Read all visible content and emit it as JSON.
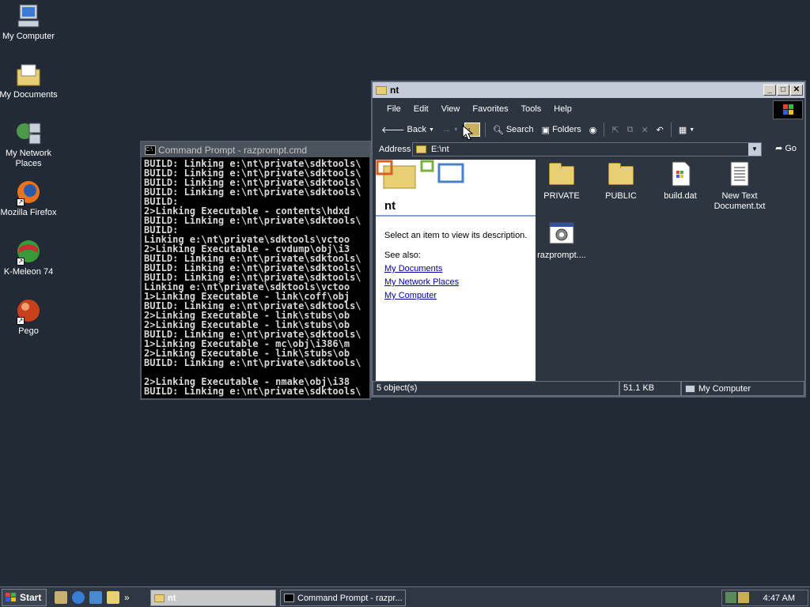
{
  "desktop": {
    "icons": [
      {
        "label": "My Computer"
      },
      {
        "label": "My Documents"
      },
      {
        "label": "My Network Places"
      },
      {
        "label": "Mozilla Firefox"
      },
      {
        "label": "K-Meleon 74"
      },
      {
        "label": "Pego"
      }
    ]
  },
  "cmd": {
    "title": "Command Prompt - razprompt.cmd",
    "lines": [
      "BUILD: Linking e:\\nt\\private\\sdktools\\",
      "BUILD: Linking e:\\nt\\private\\sdktools\\",
      "BUILD: Linking e:\\nt\\private\\sdktools\\",
      "BUILD: Linking e:\\nt\\private\\sdktools\\",
      "BUILD:",
      "2>Linking Executable - contents\\hdxd",
      "BUILD: Linking e:\\nt\\private\\sdktools\\",
      "BUILD:",
      "Linking e:\\nt\\private\\sdktools\\vctoo",
      "2>Linking Executable - cvdump\\obj\\i3",
      "BUILD: Linking e:\\nt\\private\\sdktools\\",
      "BUILD: Linking e:\\nt\\private\\sdktools\\",
      "BUILD: Linking e:\\nt\\private\\sdktools\\",
      "Linking e:\\nt\\private\\sdktools\\vctoo",
      "1>Linking Executable - link\\coff\\obj",
      "BUILD: Linking e:\\nt\\private\\sdktools\\",
      "2>Linking Executable - link\\stubs\\ob",
      "2>Linking Executable - link\\stubs\\ob",
      "BUILD: Linking e:\\nt\\private\\sdktools\\",
      "1>Linking Executable - mc\\obj\\i386\\m",
      "2>Linking Executable - link\\stubs\\ob",
      "BUILD: Linking e:\\nt\\private\\sdktools\\",
      "",
      "2>Linking Executable - nmake\\obj\\i38",
      "BUILD: Linking e:\\nt\\private\\sdktools\\"
    ]
  },
  "explorer": {
    "title": "nt",
    "menu": [
      "File",
      "Edit",
      "View",
      "Favorites",
      "Tools",
      "Help"
    ],
    "toolbar": {
      "back": "Back",
      "search": "Search",
      "folders": "Folders"
    },
    "address_label": "Address",
    "address_value": "E:\\nt",
    "go_label": "Go",
    "pane": {
      "title": "nt",
      "description": "Select an item to view its description.",
      "see_also": "See also:",
      "links": [
        "My Documents",
        "My Network Places",
        "My Computer"
      ]
    },
    "files": [
      {
        "name": "PRIVATE",
        "type": "folder"
      },
      {
        "name": "PUBLIC",
        "type": "folder"
      },
      {
        "name": "build.dat",
        "type": "file"
      },
      {
        "name": "New Text Document.txt",
        "type": "text"
      },
      {
        "name": "razprompt....",
        "type": "cmd"
      }
    ],
    "status": {
      "objects": "5 object(s)",
      "size": "51.1 KB",
      "location": "My Computer"
    }
  },
  "taskbar": {
    "start_label": "Start",
    "overflow": "»",
    "tasks": [
      {
        "label": "nt",
        "active": true
      },
      {
        "label": "Command Prompt - razpr...",
        "active": false
      }
    ],
    "clock": "4:47 AM"
  }
}
